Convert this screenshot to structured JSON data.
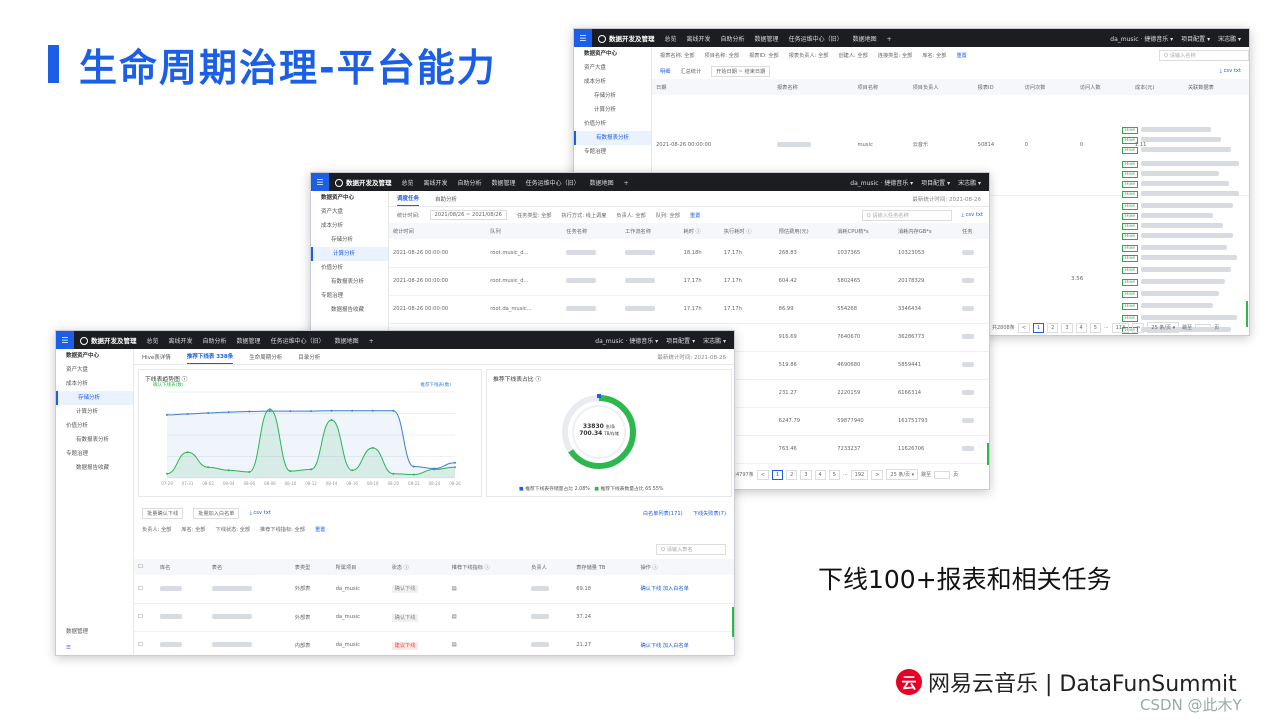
{
  "slide": {
    "title": "生命周期治理-平台能力",
    "caption": "下线100+报表和相关任务",
    "brand_logo": "云",
    "brand": "网易云音乐 | DataFunSummit",
    "watermark": "CSDN @此木Y"
  },
  "common": {
    "menu": "☰",
    "app_name": "数据开发及管理",
    "nav": [
      "总览",
      "离线开发",
      "自助分析",
      "数据管理",
      "任务运维中心（旧）",
      "数据地图"
    ],
    "nav_plus": "+",
    "user_project": "da_music · 捷德音乐 ▾",
    "project_config": "项目配置 ▾",
    "user": "宋志鹏 ▾"
  },
  "win1": {
    "sidebar": [
      "数据资产中心",
      "资产大盘",
      "成本分析",
      "存储分析",
      "计算分析",
      "价值分析",
      "有数报表分析",
      "专题治理"
    ],
    "filters": [
      "报表名称: 全部",
      "项目名称: 全部",
      "报表ID: 全部",
      "报表负责人: 全部",
      "创建人: 全部",
      "连接类型: 全部",
      "库名: 全部",
      "重置"
    ],
    "search": "Q 请输入名称",
    "csv": "⤓ csv txt",
    "tabs": [
      "明细",
      "汇总统计"
    ],
    "date_placeholder": "开始日期 ~ 结束日期",
    "columns": [
      "日期",
      "报表名称",
      "项目名称",
      "项目负责人",
      "报表ID",
      "访问次数",
      "访问人数",
      "成本(元)",
      "关联数据表"
    ],
    "row1": [
      "2021-08-26 00:00:00",
      "",
      "music",
      "云音乐",
      "50814",
      "0",
      "0",
      "1.11"
    ],
    "row2_cost": "3.56",
    "hive": "Hive",
    "pager": [
      "共2808条",
      "<",
      "1",
      "2",
      "3",
      "4",
      "5",
      "···",
      "113",
      ">",
      "25 条/页 ▾",
      "跳至",
      "页"
    ]
  },
  "win2": {
    "sidebar": [
      "数据资产中心",
      "资产大盘",
      "成本分析",
      "存储分析",
      "计算分析",
      "价值分析",
      "有数报表分析",
      "专题治理",
      "数据报告收藏"
    ],
    "tabs": [
      "调度任务",
      "自助分析"
    ],
    "update": "最新统计时间: 2021-08-26",
    "filters": [
      "统计时间:",
      "2021/08/26 ~ 2021/08/26",
      "任务类型: 全部",
      "执行方式: 线上调度",
      "负责人: 全部",
      "队列: 全部",
      "重置"
    ],
    "search": "Q 请输入任务名称",
    "csv": "⤓ csv txt",
    "columns": [
      "统计时间",
      "队列",
      "任务名称",
      "工作流名称",
      "耗时 ⓘ",
      "执行耗时 ⓘ",
      "预估费用(元)",
      "消耗CPU核*s",
      "消耗内存GB*s",
      "任务"
    ],
    "rows": [
      [
        "2021-08-26 00:00:00",
        "root.music_d...",
        "",
        "",
        "18.18h",
        "17.17h",
        "268.83",
        "1037365",
        "10323053"
      ],
      [
        "2021-08-26 00:00:00",
        "root.music_d...",
        "",
        "",
        "17.17h",
        "17.17h",
        "604.42",
        "5802465",
        "20178329"
      ],
      [
        "2021-08-26 00:00:00",
        "root.da_music...",
        "",
        "",
        "17.17h",
        "17.17h",
        "86.99",
        "554268",
        "3346434"
      ],
      [
        "",
        "",
        "",
        "",
        "",
        "",
        "916.69",
        "7640670",
        "36286773"
      ],
      [
        "",
        "",
        "",
        "",
        "",
        "",
        "519.86",
        "4690680",
        "5859441"
      ],
      [
        "",
        "",
        "",
        "",
        "",
        "",
        "231.27",
        "2220159",
        "6166314"
      ],
      [
        "",
        "",
        "",
        "",
        "",
        "",
        "6247.79",
        "59877940",
        "161751793"
      ],
      [
        "",
        "",
        "",
        "",
        "",
        "",
        "763.46",
        "7233237",
        "11626706"
      ]
    ],
    "pager": [
      "共4797条",
      "<",
      "1",
      "2",
      "3",
      "4",
      "5",
      "···",
      "192",
      ">",
      "25 条/页 ▾",
      "跳至",
      "页"
    ]
  },
  "win3": {
    "sidebar": [
      "数据资产中心",
      "资产大盘",
      "成本分析",
      "存储分析",
      "计算分析",
      "价值分析",
      "有数报表分析",
      "专题治理",
      "数据报告收藏"
    ],
    "sidebar_bottom": "数据管理",
    "tabs": [
      "Hive表详情",
      "推荐下线表 338条",
      "生命周期分析",
      "目录分析"
    ],
    "update": "最新统计时间: 2021-08-26",
    "chart1_title": "下线表趋势图 ⓘ",
    "legend_left": "确认下线表(数)",
    "legend_right": "推荐下线表(数)",
    "chart2_title": "推荐下线表占比 ⓘ",
    "donut_top": "33830",
    "donut_top_unit": "张/条",
    "donut_bottom": "700.34",
    "donut_bottom_unit": "TB/存储",
    "pie_legend": [
      "推荐下线表存储量占比 2.08%",
      "推荐下线表数量占比 65.55%"
    ],
    "actions": [
      "批量确认下线",
      "批量加入白名单",
      "⤓ csv txt"
    ],
    "links": [
      "白名单列表(171)",
      "下线失败表(7)"
    ],
    "filters": [
      "负责人: 全部",
      "库名: 全部",
      "下线状态: 全部",
      "推荐下线指标: 全部",
      "重置"
    ],
    "search": "Q 请输入表名",
    "columns": [
      "",
      "库名",
      "表名",
      "表类型",
      "所属项目",
      "状态 ⓘ",
      "推荐下线指标 ⓘ",
      "负责人",
      "表存储量 TB",
      "操作 ⓘ"
    ],
    "rows": [
      {
        "type": "外部表",
        "project": "da_music",
        "status": "确认下线",
        "size": "69.18",
        "ops": "确认下线  加入白名单"
      },
      {
        "type": "外部表",
        "project": "da_music",
        "status": "确认下线",
        "size": "37.24",
        "ops": ""
      },
      {
        "type": "内部表",
        "project": "da_music",
        "status": "建议下线",
        "size": "21.27",
        "ops": "确认下线  加入白名单"
      }
    ]
  },
  "colors": {
    "accent": "#1a5fe6",
    "green": "#2db84d",
    "dark": "#1b1d22"
  },
  "chart_data": {
    "type": "line",
    "title": "下线表趋势图",
    "x": [
      "07-29",
      "07-31",
      "08-02",
      "08-04",
      "08-06",
      "08-08",
      "08-10",
      "08-12",
      "08-14",
      "08-16",
      "08-18",
      "08-20",
      "08-22",
      "08-24",
      "08-26"
    ],
    "series": [
      {
        "name": "确认下线表(数)",
        "axis": "left",
        "values": [
          10,
          60,
          25,
          18,
          14,
          160,
          16,
          20,
          135,
          18,
          70,
          10,
          8,
          20,
          25
        ]
      },
      {
        "name": "推荐下线表(数)",
        "axis": "right",
        "values": [
          33000,
          33500,
          34000,
          34500,
          34800,
          35000,
          35000,
          35000,
          35200,
          35200,
          35200,
          35200,
          6000,
          5000,
          8000
        ]
      }
    ],
    "ylim_left": [
      0,
      200
    ],
    "ylim_right": [
      0,
      45000
    ]
  }
}
